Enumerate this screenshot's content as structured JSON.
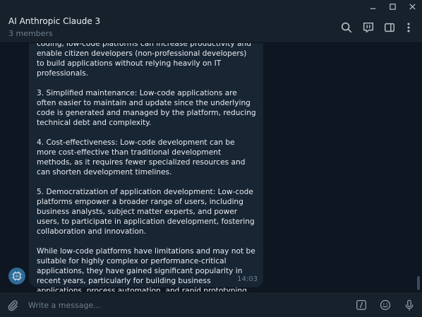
{
  "window": {
    "controls": [
      "minimize-icon",
      "maximize-icon",
      "close-icon"
    ]
  },
  "header": {
    "title": "AI Anthropic Claude 3",
    "subtitle": "3 members",
    "icons": [
      "search-icon",
      "live-stream-icon",
      "sidebar-toggle-icon",
      "more-vertical-icon"
    ]
  },
  "message": {
    "paragraphs": [
      "coding, low-code platforms can increase productivity and enable citizen developers (non-professional developers) to build applications without relying heavily on IT professionals.",
      "3. Simplified maintenance: Low-code applications are often easier to maintain and update since the underlying code is generated and managed by the platform, reducing technical debt and complexity.",
      "4. Cost-effectiveness: Low-code development can be more cost-effective than traditional development methods, as it requires fewer specialized resources and can shorten development timelines.",
      "5. Democratization of application development: Low-code platforms empower a broader range of users, including business analysts, subject matter experts, and power users, to participate in application development, fostering collaboration and innovation.",
      "While low-code platforms have limitations and may not be suitable for highly complex or performance-critical applications, they have gained significant popularity in recent years, particularly for building business applications, process automation, and rapid prototyping."
    ],
    "time": "14:03",
    "avatar_icon": "ai-chip-icon"
  },
  "composer": {
    "placeholder": "Write a message...",
    "value": "",
    "icons": [
      "attach-icon",
      "bot-commands-icon",
      "emoji-icon",
      "microphone-icon"
    ]
  },
  "colors": {
    "background": "#0e1621",
    "panel": "#17212b",
    "bubble": "#182533",
    "avatar": "#2d6a98",
    "text": "#e9edf2",
    "muted": "#6d7f8f"
  }
}
